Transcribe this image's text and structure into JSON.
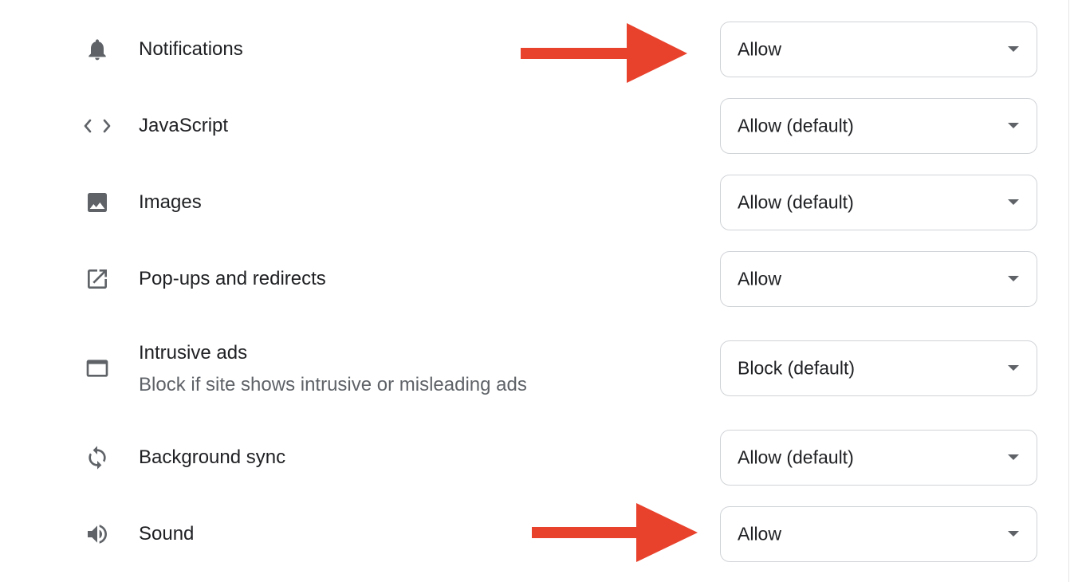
{
  "permissions": [
    {
      "id": "notifications",
      "label": "Notifications",
      "icon": "bell-icon",
      "value": "Allow"
    },
    {
      "id": "javascript",
      "label": "JavaScript",
      "icon": "code-icon",
      "value": "Allow (default)"
    },
    {
      "id": "images",
      "label": "Images",
      "icon": "image-icon",
      "value": "Allow (default)"
    },
    {
      "id": "popups",
      "label": "Pop-ups and redirects",
      "icon": "open-in-new-icon",
      "value": "Allow"
    },
    {
      "id": "ads",
      "label": "Intrusive ads",
      "sublabel": "Block if site shows intrusive or misleading ads",
      "icon": "browser-window-icon",
      "value": "Block (default)"
    },
    {
      "id": "background-sync",
      "label": "Background sync",
      "icon": "sync-icon",
      "value": "Allow (default)"
    },
    {
      "id": "sound",
      "label": "Sound",
      "icon": "speaker-icon",
      "value": "Allow"
    }
  ],
  "annotations": {
    "arrow_color": "#e8412c",
    "highlighted": [
      "notifications",
      "sound"
    ]
  }
}
